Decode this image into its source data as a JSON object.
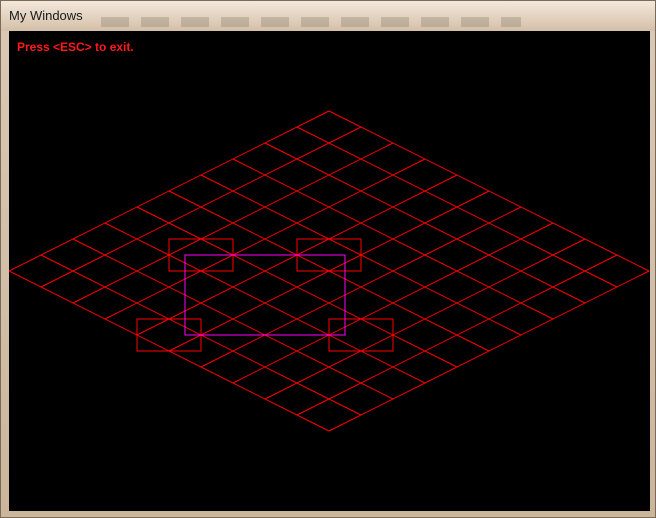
{
  "window": {
    "title": "My Windows"
  },
  "canvas": {
    "hint_text": "Press <ESC> to exit.",
    "grid_color": "#ff0000",
    "selection_color": "#ff00ff",
    "grid_cells": 10
  }
}
